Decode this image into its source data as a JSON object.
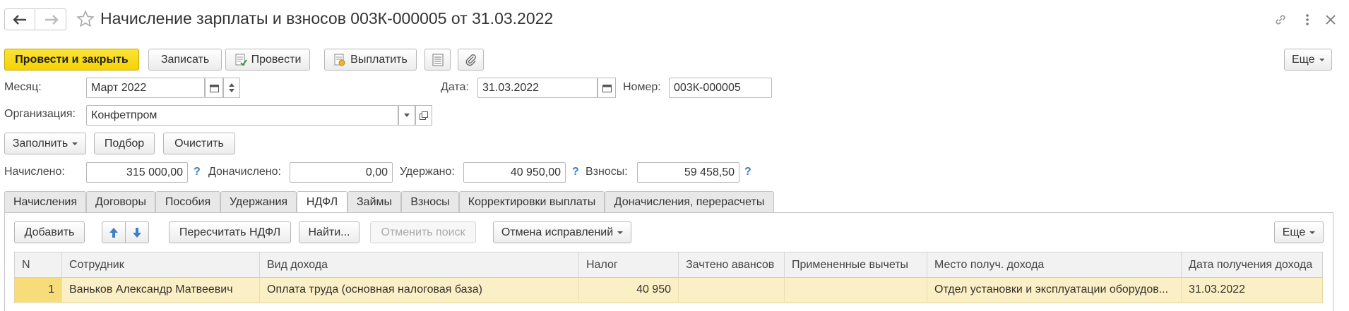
{
  "window": {
    "title": "Начисление зарплаты и взносов 003К-000005 от 31.03.2022"
  },
  "toolbar": {
    "post_close": "Провести и закрыть",
    "save": "Записать",
    "post": "Провести",
    "pay": "Выплатить",
    "more": "Еще"
  },
  "form": {
    "month_label": "Месяц:",
    "month_value": "Март 2022",
    "date_label": "Дата:",
    "date_value": "31.03.2022",
    "number_label": "Номер:",
    "number_value": "003К-000005",
    "org_label": "Организация:",
    "org_value": "Конфетпром"
  },
  "actions": {
    "fill": "Заполнить",
    "select": "Подбор",
    "clear": "Очистить"
  },
  "totals": {
    "accrued_label": "Начислено:",
    "accrued_value": "315 000,00",
    "extra_label": "Доначислено:",
    "extra_value": "0,00",
    "withheld_label": "Удержано:",
    "withheld_value": "40 950,00",
    "contrib_label": "Взносы:",
    "contrib_value": "59 458,50",
    "help": "?"
  },
  "tabs": [
    "Начисления",
    "Договоры",
    "Пособия",
    "Удержания",
    "НДФЛ",
    "Займы",
    "Взносы",
    "Корректировки выплаты",
    "Доначисления, перерасчеты"
  ],
  "tab_toolbar": {
    "add": "Добавить",
    "recalc": "Пересчитать НДФЛ",
    "find": "Найти...",
    "cancel_search": "Отменить поиск",
    "cancel_fix": "Отмена исправлений",
    "more": "Еще"
  },
  "table": {
    "columns": [
      "N",
      "Сотрудник",
      "Вид дохода",
      "Налог",
      "Зачтено авансов",
      "Примененные вычеты",
      "Место получ. дохода",
      "Дата получения дохода"
    ],
    "rows": [
      {
        "n": "1",
        "employee": "Ваньков Александр Матвеевич",
        "income_type": "Оплата труда (основная налоговая база)",
        "tax": "40 950",
        "advances": "",
        "deductions": "",
        "place": "Отдел установки и эксплуатации оборудов...",
        "date": "31.03.2022"
      }
    ]
  }
}
